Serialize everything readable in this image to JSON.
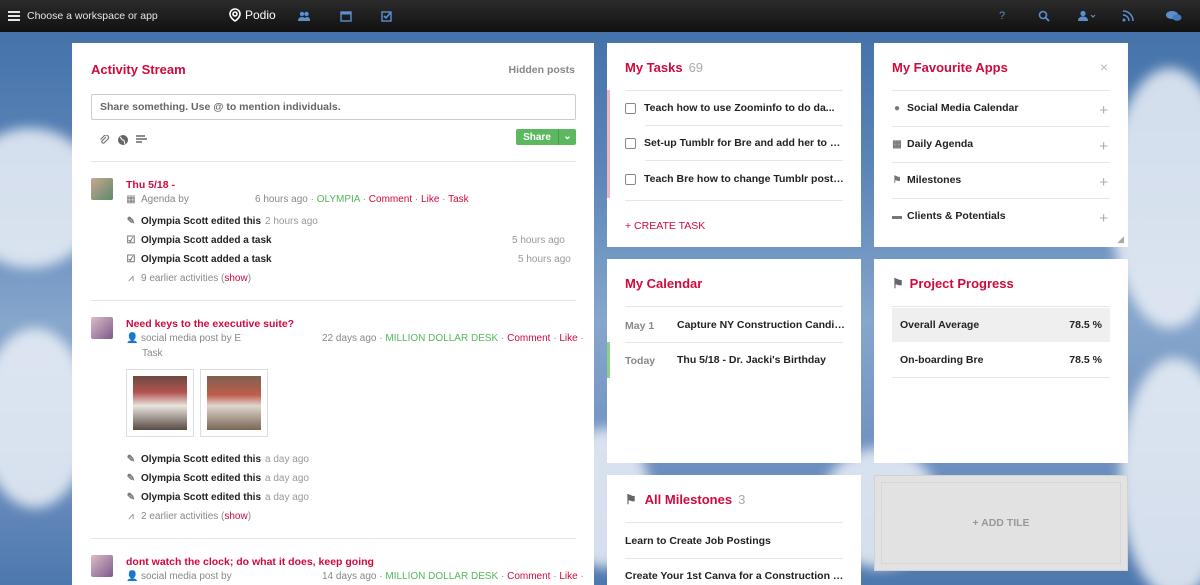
{
  "topbar": {
    "workspace_label": "Choose a workspace or app",
    "brand": "Podio"
  },
  "activity": {
    "title": "Activity Stream",
    "hidden_posts": "Hidden posts",
    "share_placeholder": "Share something. Use @ to mention individuals.",
    "share_button": "Share",
    "posts": [
      {
        "title": "Thu 5/18 -",
        "source": "Agenda by",
        "time": "6 hours ago",
        "workspace": "OLYMPIA",
        "actions": [
          "Comment",
          "Like",
          "Task"
        ],
        "activities": [
          {
            "text": "Olympia Scott edited this",
            "time": "2 hours ago"
          },
          {
            "text": "Olympia Scott added a task",
            "time": "5 hours ago"
          },
          {
            "text": "Olympia Scott added a task",
            "time": "5 hours ago"
          }
        ],
        "earlier": "9 earlier activities",
        "show": "show"
      },
      {
        "title": "Need keys to the executive suite?",
        "source": "social media post by E",
        "time": "22 days ago",
        "workspace": "MILLION DOLLAR DESK",
        "actions": [
          "Comment",
          "Like",
          "Task"
        ],
        "thumb_texts": [
          "NEED KEYS TO THE EXECUTIVE SUITE? VICE PRESIDENT CONSTRUCTION NORTHERN NJ",
          "NEED KEYS TO THE EXECUTIVE SUITE? VP CONSTRUCTION CONSULTANT NEW YORK AREA"
        ],
        "activities": [
          {
            "text": "Olympia Scott edited this",
            "time": "a day ago"
          },
          {
            "text": "Olympia Scott edited this",
            "time": "a day ago"
          },
          {
            "text": "Olympia Scott edited this",
            "time": "a day ago"
          }
        ],
        "earlier": "2 earlier activities",
        "show": "show"
      },
      {
        "title": "dont watch the clock; do what it does, keep going",
        "source": "social media post by",
        "time": "14 days ago",
        "workspace": "MILLION DOLLAR DESK",
        "actions": [
          "Comment",
          "Like"
        ]
      }
    ]
  },
  "tasks": {
    "title": "My Tasks",
    "count": "69",
    "items": [
      "Teach        how to use Zoominfo to do da...",
      "Set-up Tumblr for Bre and add her to my...",
      "Teach Bre how to change Tumblr posts f..."
    ],
    "create": "+ CREATE TASK"
  },
  "favourites": {
    "title": "My Favourite Apps",
    "close": "×",
    "apps": [
      {
        "label": "Social Media Calendar",
        "icon": "person-icon"
      },
      {
        "label": "Daily Agenda",
        "icon": "calendar-icon"
      },
      {
        "label": "Milestones",
        "icon": "flag-icon"
      },
      {
        "label": "Clients & Potentials",
        "icon": "card-icon"
      }
    ]
  },
  "calendar": {
    "title": "My Calendar",
    "events": [
      {
        "date": "May 1",
        "title": "Capture NY Construction Candida..."
      },
      {
        "date": "Today",
        "title": "Thu 5/18 - Dr. Jacki's Birthday"
      }
    ]
  },
  "progress": {
    "title": "Project Progress",
    "rows": [
      {
        "label": "Overall Average",
        "value": "78.5 %"
      },
      {
        "label": "On-boarding Bre",
        "value": "78.5 %"
      }
    ]
  },
  "milestones": {
    "title": "All Milestones",
    "count": "3",
    "items": [
      "Learn to Create Job Postings",
      "Create Your 1st Canva for a Construction Pos..."
    ]
  },
  "add_tile": "+ ADD TILE",
  "colors": {
    "accent": "#d2093c",
    "green": "#5bb85e",
    "topbar": "#1c1c1c",
    "icon_blue": "#5b8fd0"
  }
}
